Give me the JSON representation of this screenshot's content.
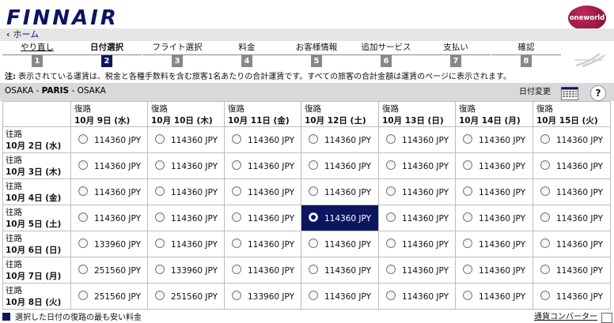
{
  "brand": {
    "logo": "FINNAIR",
    "alliance": "oneworld"
  },
  "nav": {
    "home": "ホーム"
  },
  "steps": [
    {
      "label": "やり直し",
      "num": "1",
      "state": "undo"
    },
    {
      "label": "日付選択",
      "num": "2",
      "state": "active"
    },
    {
      "label": "フライト選択",
      "num": "3",
      "state": ""
    },
    {
      "label": "料金",
      "num": "4",
      "state": ""
    },
    {
      "label": "お客様情報",
      "num": "5",
      "state": ""
    },
    {
      "label": "追加サービス",
      "num": "6",
      "state": ""
    },
    {
      "label": "支払い",
      "num": "7",
      "state": ""
    },
    {
      "label": "確認",
      "num": "8",
      "state": ""
    }
  ],
  "note": {
    "prefix": "注:",
    "text": " 表示されている運賃は、税金と各種手数料を含む旅客1名あたりの合計運賃です。すべての旅客の合計金額は運賃のページに表示されます。"
  },
  "route": {
    "origin": "OSAKA",
    "sep1": " - ",
    "dest": "PARIS",
    "sep2": " - ",
    "back": "OSAKA",
    "date_change": "日付変更",
    "help": "?"
  },
  "grid": {
    "col_label": "復路",
    "row_label": "往路",
    "cols": [
      "10月 9日 (水)",
      "10月 10日 (木)",
      "10月 11日 (金)",
      "10月 12日 (土)",
      "10月 13日 (日)",
      "10月 14日 (月)",
      "10月 15日 (火)"
    ],
    "rows": [
      {
        "date": "10月 2日 (水)",
        "prices": [
          "114360 JPY",
          "114360 JPY",
          "114360 JPY",
          "114360 JPY",
          "114360 JPY",
          "114360 JPY",
          "114360 JPY"
        ]
      },
      {
        "date": "10月 3日 (木)",
        "prices": [
          "114360 JPY",
          "114360 JPY",
          "114360 JPY",
          "114360 JPY",
          "114360 JPY",
          "114360 JPY",
          "114360 JPY"
        ]
      },
      {
        "date": "10月 4日 (金)",
        "prices": [
          "114360 JPY",
          "114360 JPY",
          "114360 JPY",
          "114360 JPY",
          "114360 JPY",
          "114360 JPY",
          "114360 JPY"
        ]
      },
      {
        "date": "10月 5日 (土)",
        "prices": [
          "114360 JPY",
          "114360 JPY",
          "114360 JPY",
          "114360 JPY",
          "114360 JPY",
          "114360 JPY",
          "114360 JPY"
        ]
      },
      {
        "date": "10月 6日 (日)",
        "prices": [
          "133960 JPY",
          "114360 JPY",
          "114360 JPY",
          "114360 JPY",
          "114360 JPY",
          "114360 JPY",
          "114360 JPY"
        ]
      },
      {
        "date": "10月 7日 (月)",
        "prices": [
          "251560 JPY",
          "133960 JPY",
          "114360 JPY",
          "114360 JPY",
          "114360 JPY",
          "114360 JPY",
          "114360 JPY"
        ]
      },
      {
        "date": "10月 8日 (火)",
        "prices": [
          "251560 JPY",
          "251560 JPY",
          "133960 JPY",
          "114360 JPY",
          "114360 JPY",
          "114360 JPY",
          "114360 JPY"
        ]
      }
    ],
    "selected": {
      "row": 3,
      "col": 3
    }
  },
  "legend": {
    "text": "選択した日付の復路の最も安い料金"
  },
  "currency": {
    "label": "通貨コンバーター"
  },
  "colors": {
    "brand": "#0b1560",
    "route_bar": "#d9d9d9"
  }
}
